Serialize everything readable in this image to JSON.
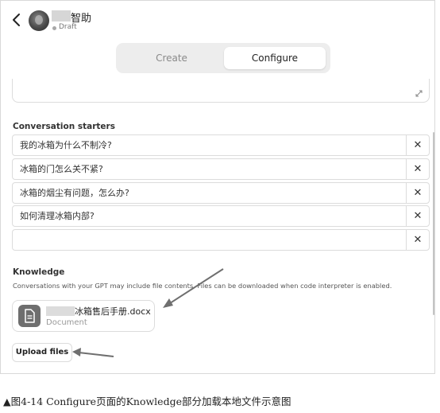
{
  "header": {
    "back_icon": "chevron-left-icon",
    "gpt_name": "智助",
    "status": "Draft"
  },
  "tabs": [
    {
      "label": "Create",
      "active": false
    },
    {
      "label": "Configure",
      "active": true
    }
  ],
  "conversation_starters": {
    "label": "Conversation starters",
    "items": [
      {
        "text": "我的冰箱为什么不制冷?"
      },
      {
        "text": "冰箱的门怎么关不紧?"
      },
      {
        "text": "冰箱的烟尘有问题，怎么办?"
      },
      {
        "text": "如何清理冰箱内部?"
      },
      {
        "text": ""
      }
    ],
    "clear_label": "✕"
  },
  "knowledge": {
    "label": "Knowledge",
    "description": "Conversations with your GPT may include file contents. Files can be downloaded when code interpreter is enabled.",
    "file": {
      "name": "冰箱售后手册.docx",
      "type": "Document",
      "icon": "document-icon"
    },
    "upload_label": "Upload files"
  },
  "caption": "▲图4-14 Configure页面的Knowledge部分加载本地文件示意图",
  "colors": {
    "arrow": "#6f6f6f",
    "file_icon_bg": "#6e6e6e",
    "border": "#dcdcdc"
  }
}
